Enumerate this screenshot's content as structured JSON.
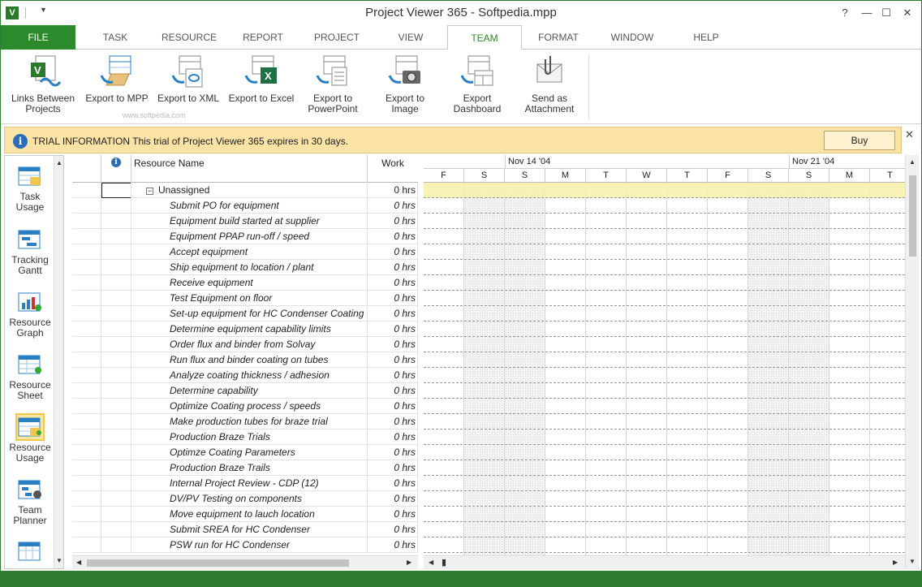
{
  "window": {
    "title": "Project Viewer 365 - Softpedia.mpp",
    "app_icon": "V"
  },
  "tabs": [
    {
      "label": "FILE"
    },
    {
      "label": "TASK"
    },
    {
      "label": "RESOURCE"
    },
    {
      "label": "REPORT"
    },
    {
      "label": "PROJECT"
    },
    {
      "label": "VIEW"
    },
    {
      "label": "TEAM"
    },
    {
      "label": "FORMAT"
    },
    {
      "label": "WINDOW"
    },
    {
      "label": "HELP"
    }
  ],
  "active_tab": "TEAM",
  "ribbon": {
    "buttons": [
      {
        "line1": "Links Between",
        "line2": "Projects",
        "icon": "links-between-projects-icon"
      },
      {
        "line1": "Export to MPP",
        "line2": "",
        "icon": "export-mpp-icon"
      },
      {
        "line1": "Export to XML",
        "line2": "",
        "icon": "export-xml-icon"
      },
      {
        "line1": "Export to Excel",
        "line2": "",
        "icon": "export-excel-icon"
      },
      {
        "line1": "Export to",
        "line2": "PowerPoint",
        "icon": "export-powerpoint-icon"
      },
      {
        "line1": "Export to Image",
        "line2": "",
        "icon": "export-image-icon"
      },
      {
        "line1": "Export",
        "line2": "Dashboard",
        "icon": "export-dashboard-icon"
      },
      {
        "line1": "Send as",
        "line2": "Attachment",
        "icon": "send-attachment-icon"
      }
    ],
    "watermark": "www.softpedia.com"
  },
  "infobar": {
    "label": "TRIAL INFORMATION",
    "message": "This trial of Project Viewer 365 expires in 30 days.",
    "buy_label": "Buy"
  },
  "views": [
    {
      "line1": "Task Usage",
      "line2": ""
    },
    {
      "line1": "Tracking",
      "line2": "Gantt"
    },
    {
      "line1": "Resource",
      "line2": "Graph"
    },
    {
      "line1": "Resource",
      "line2": "Sheet"
    },
    {
      "line1": "Resource",
      "line2": "Usage"
    },
    {
      "line1": "Team",
      "line2": "Planner"
    }
  ],
  "selected_view": "Resource Usage",
  "grid": {
    "col_info_icon": "i",
    "col_name": "Resource Name",
    "col_work": "Work",
    "group": {
      "name": "Unassigned",
      "work": "0 hrs"
    },
    "rows": [
      {
        "name": "Submit PO for equipment",
        "work": "0 hrs"
      },
      {
        "name": "Equipment build started at supplier",
        "work": "0 hrs"
      },
      {
        "name": "Equipment PPAP run-off / speed",
        "work": "0 hrs"
      },
      {
        "name": "Accept equipment",
        "work": "0 hrs"
      },
      {
        "name": "Ship equipment to location / plant",
        "work": "0 hrs"
      },
      {
        "name": "Receive equipment",
        "work": "0 hrs"
      },
      {
        "name": "Test Equipment on floor",
        "work": "0 hrs"
      },
      {
        "name": "Set-up equipment for HC Condenser Coating",
        "work": "0 hrs"
      },
      {
        "name": "Determine equipment capability limits",
        "work": "0 hrs"
      },
      {
        "name": "Order flux and binder from Solvay",
        "work": "0 hrs"
      },
      {
        "name": "Run flux and binder coating on tubes",
        "work": "0 hrs"
      },
      {
        "name": "Analyze coating thickness / adhesion",
        "work": "0 hrs"
      },
      {
        "name": "Determine capability",
        "work": "0 hrs"
      },
      {
        "name": "Optimize Coating process / speeds",
        "work": "0 hrs"
      },
      {
        "name": "Make production tubes for braze trial",
        "work": "0 hrs"
      },
      {
        "name": "Production Braze Trials",
        "work": "0 hrs"
      },
      {
        "name": "Optimze Coating Parameters",
        "work": "0 hrs"
      },
      {
        "name": "Production Braze Trails",
        "work": "0 hrs"
      },
      {
        "name": "Internal Project Review - CDP (12)",
        "work": "0 hrs"
      },
      {
        "name": "DV/PV Testing on components",
        "work": "0 hrs"
      },
      {
        "name": "Move equipment to lauch location",
        "work": "0 hrs"
      },
      {
        "name": "Submit SREA for HC Condenser",
        "work": "0 hrs"
      },
      {
        "name": "PSW run for HC Condenser",
        "work": "0 hrs"
      }
    ]
  },
  "timescale": {
    "weeks": [
      {
        "label": "Nov 14 '04",
        "start_day_index": 2
      },
      {
        "label": "Nov 21 '04",
        "start_day_index": 9
      }
    ],
    "days": [
      {
        "label": "F",
        "weekend": false
      },
      {
        "label": "S",
        "weekend": true
      },
      {
        "label": "S",
        "weekend": true
      },
      {
        "label": "M",
        "weekend": false
      },
      {
        "label": "T",
        "weekend": false
      },
      {
        "label": "W",
        "weekend": false
      },
      {
        "label": "T",
        "weekend": false
      },
      {
        "label": "F",
        "weekend": false
      },
      {
        "label": "S",
        "weekend": true
      },
      {
        "label": "S",
        "weekend": true
      },
      {
        "label": "M",
        "weekend": false
      },
      {
        "label": "T",
        "weekend": false
      }
    ]
  },
  "colors": {
    "accent": "#2b8a2b",
    "trial_bar": "#fbe3a6",
    "selected_row": "#f8f0aa"
  }
}
